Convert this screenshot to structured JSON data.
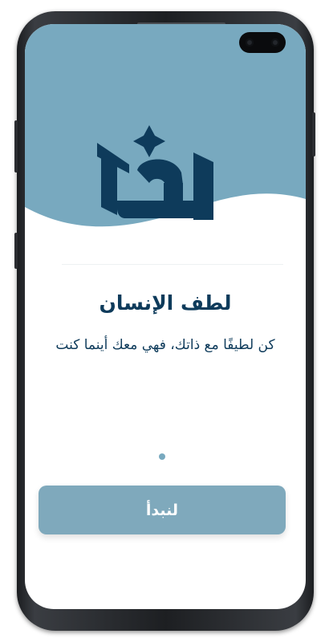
{
  "colors": {
    "accent": "#78a9bf",
    "brand_dark": "#0e3b5b",
    "button": "#7fa9bc",
    "button_text": "#ffffff"
  },
  "hero": {
    "logo_icon": "brand-logo-icon",
    "logo_alt": "لطف"
  },
  "onboarding": {
    "title": "لطف الإنسان",
    "subtitle": "كن لطيفًا مع ذاتك، فهي معك أينما كنت",
    "page_indicator": "1"
  },
  "cta": {
    "label": "لنبدأ"
  }
}
